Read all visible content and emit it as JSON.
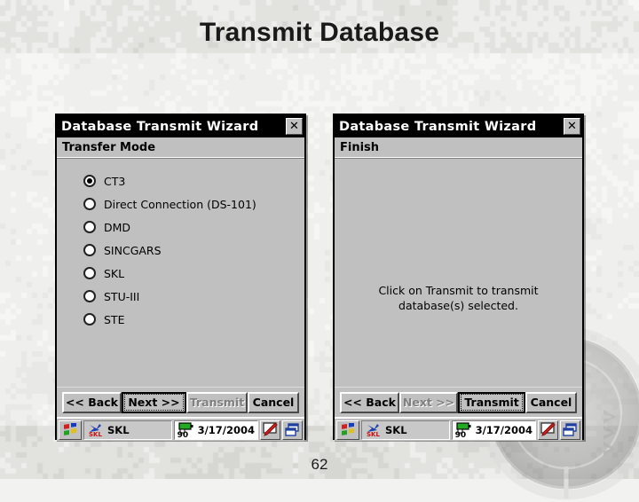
{
  "slide": {
    "title": "Transmit Database",
    "page_number": "62",
    "background": "digital-camouflage",
    "colors": {
      "dialog_face": "#c0c0c0",
      "titlebar": "#000000",
      "titlebar_text": "#ffffff",
      "disabled_text": "#808080",
      "battery_green": "#22aa22",
      "pen_red": "#cc2020",
      "window_blue": "#2040a0"
    }
  },
  "dialogs": [
    {
      "id": "transfer-mode",
      "titlebar": {
        "title": "Database Transmit Wizard",
        "close_label": "✕",
        "close_icon": "close-icon"
      },
      "page_heading": "Transfer Mode",
      "radio_options": [
        {
          "label": "CT3",
          "checked": true
        },
        {
          "label": "Direct Connection (DS-101)",
          "checked": false
        },
        {
          "label": "DMD",
          "checked": false
        },
        {
          "label": "SINCGARS",
          "checked": false
        },
        {
          "label": "SKL",
          "checked": false
        },
        {
          "label": "STU-III",
          "checked": false
        },
        {
          "label": "STE",
          "checked": false
        }
      ],
      "buttons": [
        {
          "label": "<< Back",
          "state": "enabled"
        },
        {
          "label": "Next >>",
          "state": "focused"
        },
        {
          "label": "Transmit",
          "state": "disabled"
        },
        {
          "label": "Cancel",
          "state": "enabled"
        }
      ],
      "taskbar": {
        "start_icon": "windows-start-icon",
        "task_item": {
          "label": "SKL",
          "icon": "skl-app-icon"
        },
        "battery_percent": "90",
        "battery_icon": "battery-icon",
        "date": "3/17/2004",
        "tray_buttons": [
          {
            "icon": "stylus-pen-icon"
          },
          {
            "icon": "switch-windows-icon"
          }
        ]
      }
    },
    {
      "id": "finish",
      "titlebar": {
        "title": "Database Transmit Wizard",
        "close_label": "✕",
        "close_icon": "close-icon"
      },
      "page_heading": "Finish",
      "message": "Click on Transmit to transmit database(s) selected.",
      "buttons": [
        {
          "label": "<< Back",
          "state": "enabled"
        },
        {
          "label": "Next >>",
          "state": "disabled"
        },
        {
          "label": "Transmit",
          "state": "focused"
        },
        {
          "label": "Cancel",
          "state": "enabled"
        }
      ],
      "taskbar": {
        "start_icon": "windows-start-icon",
        "task_item": {
          "label": "SKL",
          "icon": "skl-app-icon"
        },
        "battery_percent": "90",
        "battery_icon": "battery-icon",
        "date": "3/17/2004",
        "tray_buttons": [
          {
            "icon": "stylus-pen-icon"
          },
          {
            "icon": "switch-windows-icon"
          }
        ]
      }
    }
  ]
}
